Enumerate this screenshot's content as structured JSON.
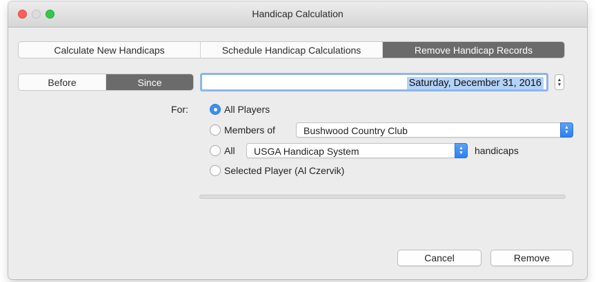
{
  "window": {
    "title": "Handicap Calculation"
  },
  "tabs": [
    {
      "label": "Calculate New Handicaps",
      "active": false
    },
    {
      "label": "Schedule Handicap Calculations",
      "active": false
    },
    {
      "label": "Remove Handicap Records",
      "active": true
    }
  ],
  "mode": {
    "options": [
      "Before",
      "Since"
    ],
    "selected": "Since"
  },
  "date": {
    "value": "Saturday, December 31, 2016"
  },
  "for": {
    "label": "For:",
    "options": {
      "all_players": "All Players",
      "members_of": "Members of",
      "all": "All",
      "selected_player": "Selected Player (Al Czervik)"
    },
    "selected": "all_players",
    "club_value": "Bushwood Country Club",
    "system_value": "USGA Handicap System",
    "handicaps_suffix": "handicaps"
  },
  "progress": {
    "value": 0
  },
  "buttons": {
    "cancel": "Cancel",
    "remove": "Remove"
  },
  "icons": {
    "stepper": "up-down-arrows-icon",
    "popup": "chevron-up-down-icon"
  },
  "colors": {
    "accent": "#3b8ff0",
    "selected_segment": "#6b6b6b",
    "text_selection": "#b3d2f8",
    "close": "#fc5f57",
    "zoom": "#34c84a"
  }
}
